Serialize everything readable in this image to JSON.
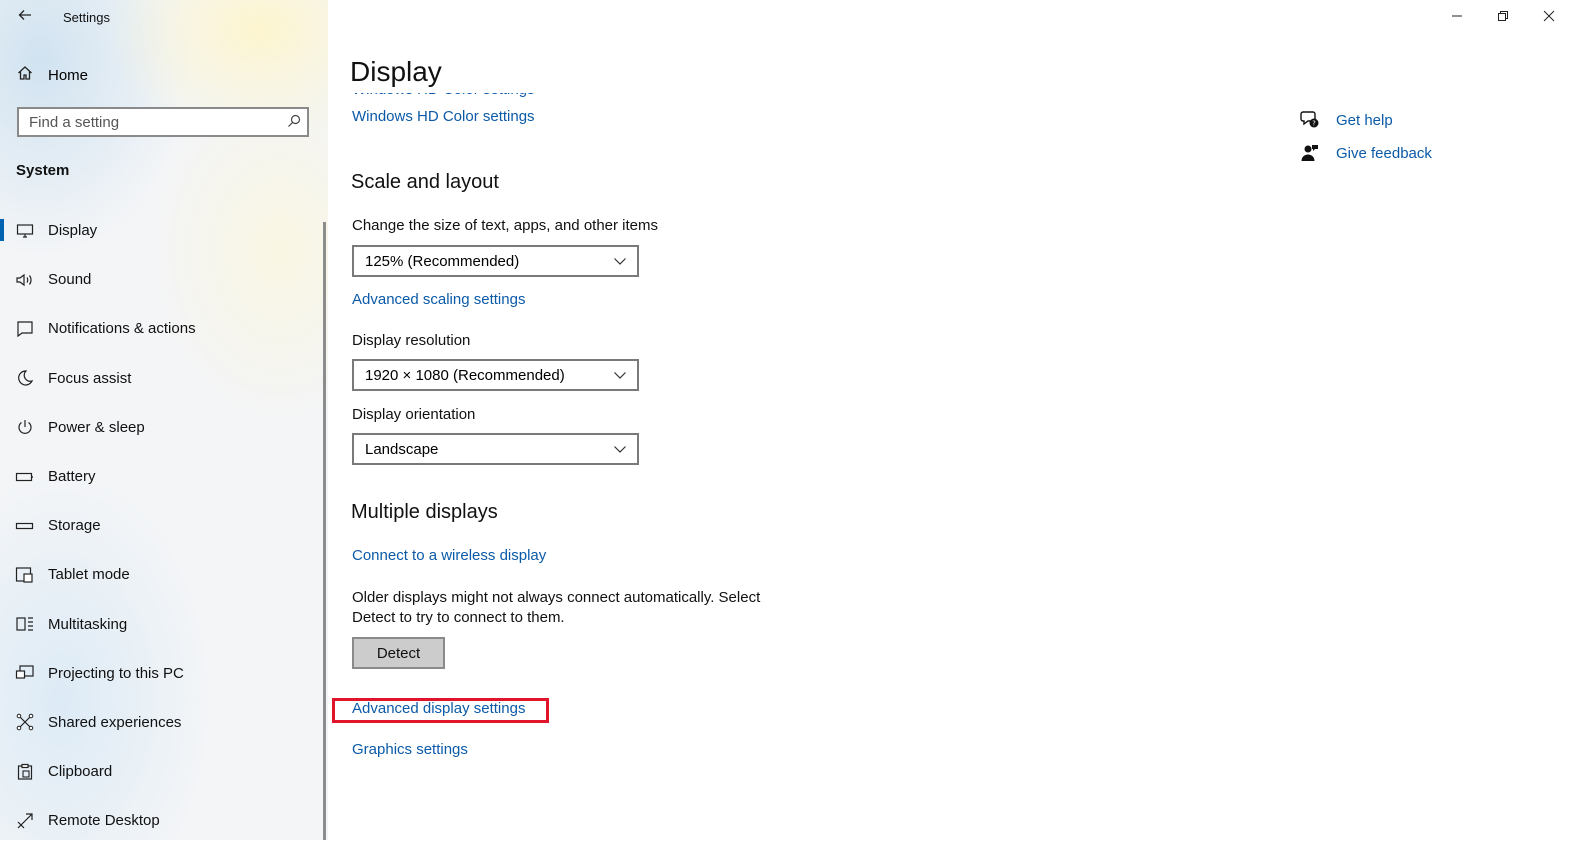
{
  "window": {
    "title": "Settings"
  },
  "sidebar": {
    "home_label": "Home",
    "search": {
      "placeholder": "Find a setting"
    },
    "section_label": "System",
    "items": [
      {
        "label": "Display",
        "icon": "monitor-icon",
        "active": true
      },
      {
        "label": "Sound",
        "icon": "speaker-icon"
      },
      {
        "label": "Notifications & actions",
        "icon": "notification-icon"
      },
      {
        "label": "Focus assist",
        "icon": "moon-icon"
      },
      {
        "label": "Power & sleep",
        "icon": "power-icon"
      },
      {
        "label": "Battery",
        "icon": "battery-icon"
      },
      {
        "label": "Storage",
        "icon": "storage-icon"
      },
      {
        "label": "Tablet mode",
        "icon": "tablet-mode-icon"
      },
      {
        "label": "Multitasking",
        "icon": "multitasking-icon"
      },
      {
        "label": "Projecting to this PC",
        "icon": "projecting-icon"
      },
      {
        "label": "Shared experiences",
        "icon": "shared-experiences-icon"
      },
      {
        "label": "Clipboard",
        "icon": "clipboard-icon"
      },
      {
        "label": "Remote Desktop",
        "icon": "remote-desktop-icon"
      }
    ]
  },
  "main": {
    "title": "Display",
    "hd_color_link": "Windows HD Color settings",
    "scale_layout": {
      "heading": "Scale and layout",
      "scale_label": "Change the size of text, apps, and other items",
      "scale_value": "125% (Recommended)",
      "advanced_scaling_link": "Advanced scaling settings",
      "resolution_label": "Display resolution",
      "resolution_value": "1920 × 1080 (Recommended)",
      "orientation_label": "Display orientation",
      "orientation_value": "Landscape"
    },
    "multiple_displays": {
      "heading": "Multiple displays",
      "wireless_link": "Connect to a wireless display",
      "description": "Older displays might not always connect automatically. Select Detect to try to connect to them.",
      "detect_button": "Detect",
      "advanced_display_link": "Advanced display settings",
      "graphics_link": "Graphics settings"
    }
  },
  "help": {
    "get_help": "Get help",
    "give_feedback": "Give feedback"
  },
  "colors": {
    "accent": "#0063b1",
    "link": "#0b5aa8",
    "highlight": "#e0142b"
  }
}
